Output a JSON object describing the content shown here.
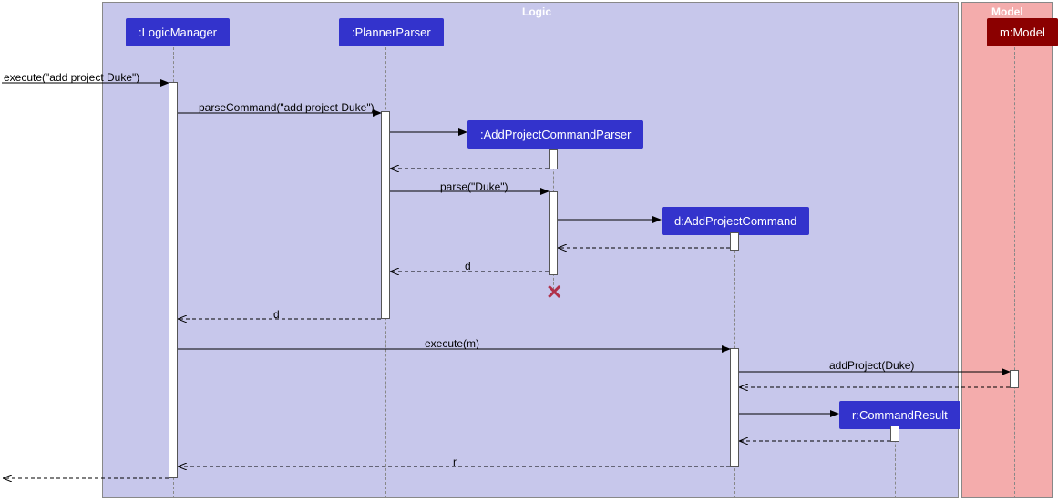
{
  "frames": {
    "logic": "Logic",
    "model": "Model"
  },
  "participants": {
    "logicManager": ":LogicManager",
    "plannerParser": ":PlannerParser",
    "addProjectCommandParser": ":AddProjectCommandParser",
    "addProjectCommand": "d:AddProjectCommand",
    "commandResult": "r:CommandResult",
    "model": "m:Model"
  },
  "messages": {
    "execute1": "execute(\"add project Duke\")",
    "parseCommand": "parseCommand(\"add project Duke\")",
    "parse": "parse(\"Duke\")",
    "returnD1": "d",
    "returnD2": "d",
    "executeM": "execute(m)",
    "addProject": "addProject(Duke)",
    "returnR": "r"
  }
}
